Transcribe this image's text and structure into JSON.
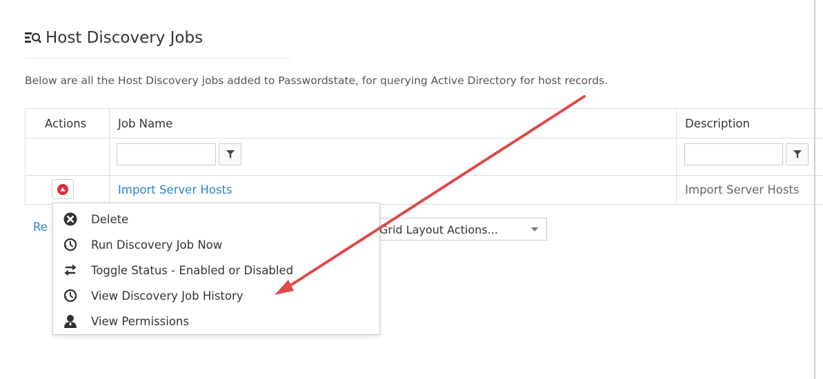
{
  "page": {
    "title": "Host Discovery Jobs",
    "description": "Below are all the Host Discovery jobs added to Passwordstate, for querying Active Directory for host records."
  },
  "grid": {
    "columns": {
      "actions": "Actions",
      "job_name": "Job Name",
      "description": "Description"
    },
    "filters": {
      "job_name": "",
      "description": ""
    },
    "rows": [
      {
        "job_name": "Import Server Hosts",
        "description": "Import Server Hosts"
      }
    ]
  },
  "footer": {
    "refresh_label": "Re",
    "layout_actions_label": "Grid Layout Actions..."
  },
  "menu": {
    "items": [
      {
        "label": "Delete",
        "icon": "delete-circle-icon"
      },
      {
        "label": "Run Discovery Job Now",
        "icon": "clock-icon"
      },
      {
        "label": "Toggle Status - Enabled or Disabled",
        "icon": "swap-arrows-icon"
      },
      {
        "label": "View Discovery Job History",
        "icon": "clock-icon"
      },
      {
        "label": "View Permissions",
        "icon": "user-permissions-icon"
      }
    ]
  },
  "colors": {
    "link": "#2a83c5",
    "action_button": "#e02b3c",
    "annotation_arrow": "#e04848"
  }
}
